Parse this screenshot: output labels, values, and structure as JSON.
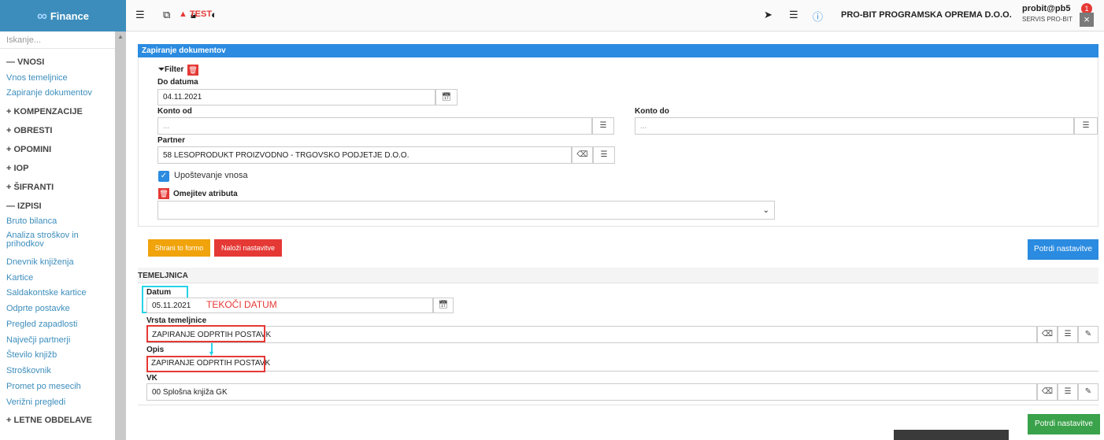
{
  "header": {
    "app_name": "Finance",
    "test_label": "TEST",
    "company": "PRO-BIT PROGRAMSKA OPREMA D.O.O.",
    "user_email": "probit@pb5",
    "user_sub": "SERVIS PRO-BIT",
    "notif_count": "1",
    "close": "×"
  },
  "sidebar": {
    "search_placeholder": "Iskanje...",
    "items": [
      {
        "label": "— VNOSI"
      },
      {
        "label": "Vnos temeljnice"
      },
      {
        "label": "Zapiranje dokumentov"
      },
      {
        "label": "+ KOMPENZACIJE"
      },
      {
        "label": "+ OBRESTI"
      },
      {
        "label": "+ OPOMINI"
      },
      {
        "label": "+ IOP"
      },
      {
        "label": "+ ŠIFRANTI"
      },
      {
        "label": "— IZPISI"
      },
      {
        "label": "Bruto bilanca"
      },
      {
        "label": "Analiza stroškov in prihodkov"
      },
      {
        "label": "Dnevnik knjiženja"
      },
      {
        "label": "Kartice"
      },
      {
        "label": "Saldakontske kartice"
      },
      {
        "label": "Odprte postavke"
      },
      {
        "label": "Pregled zapadlosti"
      },
      {
        "label": "Največji partnerji"
      },
      {
        "label": "Število knjižb"
      },
      {
        "label": "Stroškovnik"
      },
      {
        "label": "Promet po mesecih"
      },
      {
        "label": "Verižni pregledi"
      },
      {
        "label": "+ LETNE OBDELAVE"
      }
    ]
  },
  "panel": {
    "title": "Zapiranje dokumentov",
    "filter_label": "Filter",
    "do_datuma_label": "Do datuma",
    "do_datuma_value": "04.11.2021",
    "konto_od_label": "Konto od",
    "konto_od_placeholder": "...",
    "konto_do_label": "Konto do",
    "konto_do_placeholder": "...",
    "partner_label": "Partner",
    "partner_value": "58 LESOPRODUKT PROIZVODNO - TRGOVSKO PODJETJE D.O.O.",
    "upostevanje_label": "Upoštevanje vnosa",
    "omejitev_label": "Omejitev atributa",
    "omejitev_value": ""
  },
  "buttons": {
    "shrani": "Shrani to formo",
    "nalozi": "Naloži nastavitve",
    "potrdi_top": "Potrdi nastavitve",
    "potrdi_bottom": "Potrdi nastavitve"
  },
  "temeljnica": {
    "title": "TEMELJNICA",
    "datum_label": "Datum",
    "datum_value": "05.11.2021",
    "annotation": "TEKOČI DATUM",
    "vrsta_label": "Vrsta temeljnice",
    "vrsta_value": "ZAPIRANJE ODPRTIH POSTAVK",
    "opis_label": "Opis",
    "opis_value": "ZAPIRANJE ODPRTIH POSTAVK",
    "vk_label": "VK",
    "vk_value": "00 Splošna knjiža GK"
  },
  "colors": {
    "brand": "#3c8dbc",
    "panel_head": "#2a8be0",
    "warning": "#f0a30a",
    "danger": "#e53935",
    "primary": "#2a8be0",
    "success": "#3aa24a",
    "annotation_cyan": "#26d3e8"
  }
}
